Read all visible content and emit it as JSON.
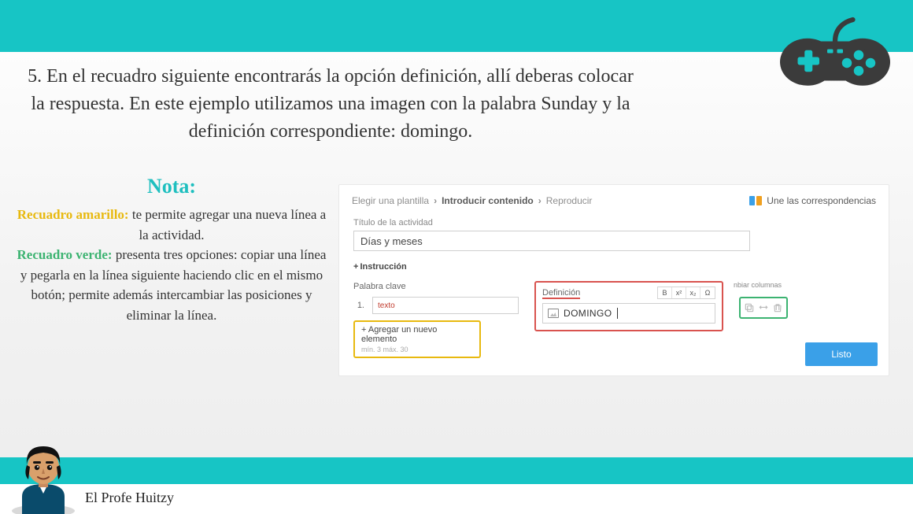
{
  "slide": {
    "heading": "5. En el recuadro siguiente encontrarás la opción definición, allí deberas colocar la respuesta. En este ejemplo utilizamos una imagen con la palabra Sunday y la definición correspondiente: domingo.",
    "notes_title": "Nota:",
    "note_yellow_label": "Recuadro amarillo:",
    "note_yellow_text": " te permite agregar una nueva línea a la actividad.",
    "note_green_label": "Recuadro verde:",
    "note_green_text": " presenta tres opciones: copiar una línea y pegarla en la línea siguiente haciendo clic en el mismo botón; permite además intercambiar las posiciones y  eliminar la línea.",
    "footer": "El Profe Huitzy"
  },
  "app": {
    "breadcrumbs": {
      "a": "Elegir una plantilla",
      "b": "Introducir contenido",
      "c": "Reproducir"
    },
    "match_link": "Une las correspondencias",
    "title_label": "Título de la actividad",
    "title_value": "Días y meses",
    "instruccion": "Instrucción",
    "keyword_label": "Palabra clave",
    "definition_label": "Definición",
    "toolbar": {
      "bold": "B",
      "sup": "x²",
      "sub": "x₂",
      "omega": "Ω"
    },
    "swap_columns": "nbiar columnas",
    "row_number": "1.",
    "keyword_value": "texto",
    "definition_value": "DOMINGO",
    "add_element": "Agregar un nuevo elemento",
    "add_hint": "mín. 3   máx. 30",
    "done": "Listo"
  }
}
